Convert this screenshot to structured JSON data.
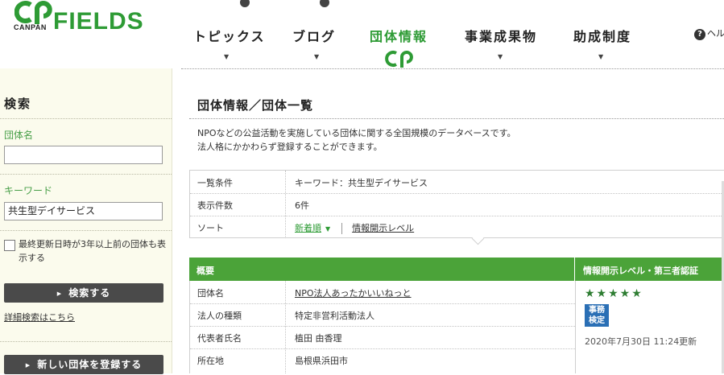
{
  "logo": {
    "canpan": "CANPAN",
    "fields": "FIELDS"
  },
  "nav": {
    "items": [
      {
        "label": "トピックス"
      },
      {
        "label": "ブログ"
      },
      {
        "label": "団体情報"
      },
      {
        "label": "事業成果物"
      },
      {
        "label": "助成制度"
      }
    ],
    "help": "ヘル"
  },
  "sidebar": {
    "title": "検索",
    "org_name_label": "団体名",
    "org_name_value": "",
    "keyword_label": "キーワード",
    "keyword_value": "共生型デイサービス",
    "old_orgs_label": "最終更新日時が3年以上前の団体も表示する",
    "search_button": "検索する",
    "advanced_link": "詳細検索はこちら",
    "register_button": "新しい団体を登録する"
  },
  "main": {
    "title": "団体情報／団体一覧",
    "description_line1": "NPOなどの公益活動を実施している団体に関する全国規模のデータベースです。",
    "description_line2": "法人格にかかわらず登録することができます。",
    "conditions": {
      "cond_label": "一覧条件",
      "cond_value": "キーワード：共生型デイサービス",
      "count_label": "表示件数",
      "count_value": "6件",
      "sort_label": "ソート",
      "sort_active": "新着順",
      "sort_other": "情報開示レベル"
    },
    "results": {
      "head_left": "概要",
      "head_right": "情報開示レベル・第三者認証",
      "rows": [
        {
          "k": "団体名",
          "v": "NPO法人あったかいいねっと"
        },
        {
          "k": "法人の種類",
          "v": "特定非営利活動法人"
        },
        {
          "k": "代表者氏名",
          "v": "植田 由香理"
        },
        {
          "k": "所在地",
          "v": "島根県浜田市"
        }
      ],
      "stars": 5,
      "badge_line1": "事務",
      "badge_line2": "検定",
      "updated": "2020年7月30日 11:24更新"
    }
  },
  "colors": {
    "brand_green": "#2e9b35",
    "header_green": "#4ba339",
    "badge_blue": "#2a6fb5"
  }
}
